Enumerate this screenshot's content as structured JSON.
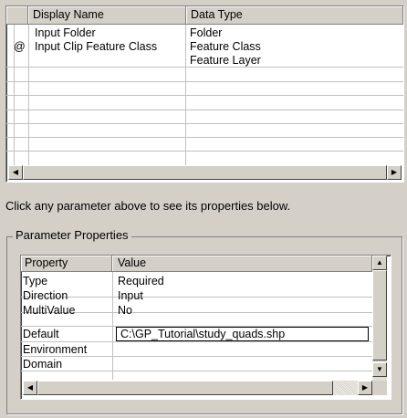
{
  "params_grid": {
    "columns": [
      "Display Name",
      "Data Type"
    ],
    "rows": [
      {
        "marker": "",
        "name": "Input Folder",
        "type": "Folder"
      },
      {
        "marker": "@",
        "name": "Input Clip Feature Class",
        "type": "Feature Class"
      },
      {
        "marker": "",
        "name": "",
        "type": "Feature Layer"
      }
    ]
  },
  "hint": "Click any parameter above to see its properties below.",
  "group_title": "Parameter Properties",
  "property_grid": {
    "columns": [
      "Property",
      "Value"
    ],
    "rows": [
      {
        "property": "Type",
        "value": "Required"
      },
      {
        "property": "Direction",
        "value": "Input"
      },
      {
        "property": "MultiValue",
        "value": "No"
      },
      {
        "property": "Default",
        "value": "C:\\GP_Tutorial\\study_quads.shp"
      },
      {
        "property": "Environment",
        "value": ""
      },
      {
        "property": "Domain",
        "value": ""
      }
    ]
  },
  "icons": {
    "scroll_left": "arrow-left-icon",
    "scroll_right": "arrow-right-icon",
    "scroll_up": "arrow-up-icon",
    "scroll_down": "arrow-down-icon"
  }
}
